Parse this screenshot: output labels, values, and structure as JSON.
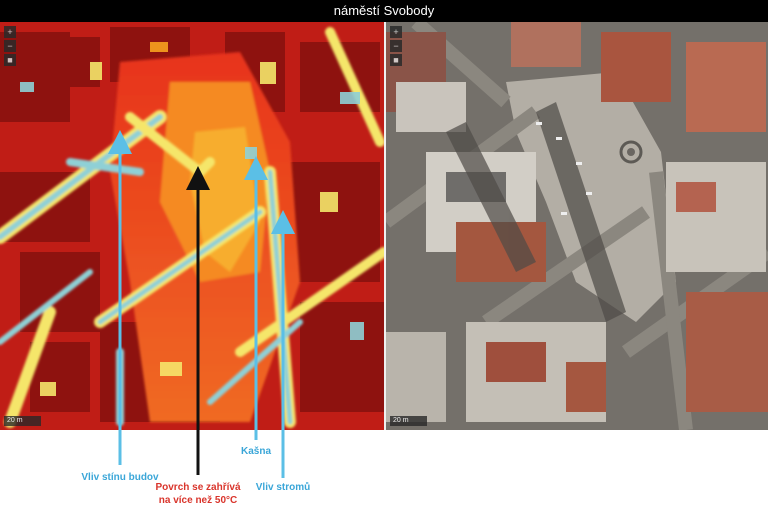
{
  "title": "náměstí Svobody",
  "scale_label": "20 m",
  "colors": {
    "heat_hot": "#b51712",
    "heat_warm": "#ef4a1c",
    "heat_mid": "#f7a21f",
    "heat_cool": "#f5e86a",
    "heat_cold": "#8fd0d6",
    "arrow_blue": "#5bbfe6",
    "arrow_black": "#111111",
    "label_blue": "#3aa6d8",
    "label_red": "#d9342b"
  },
  "annotations": {
    "shadow_buildings": "Vliv stínu budov",
    "surface_heat_line1": "Povrch se zahřívá",
    "surface_heat_line2": "na více než 50°C",
    "fountain": "Kašna",
    "trees": "Vliv stromů"
  }
}
